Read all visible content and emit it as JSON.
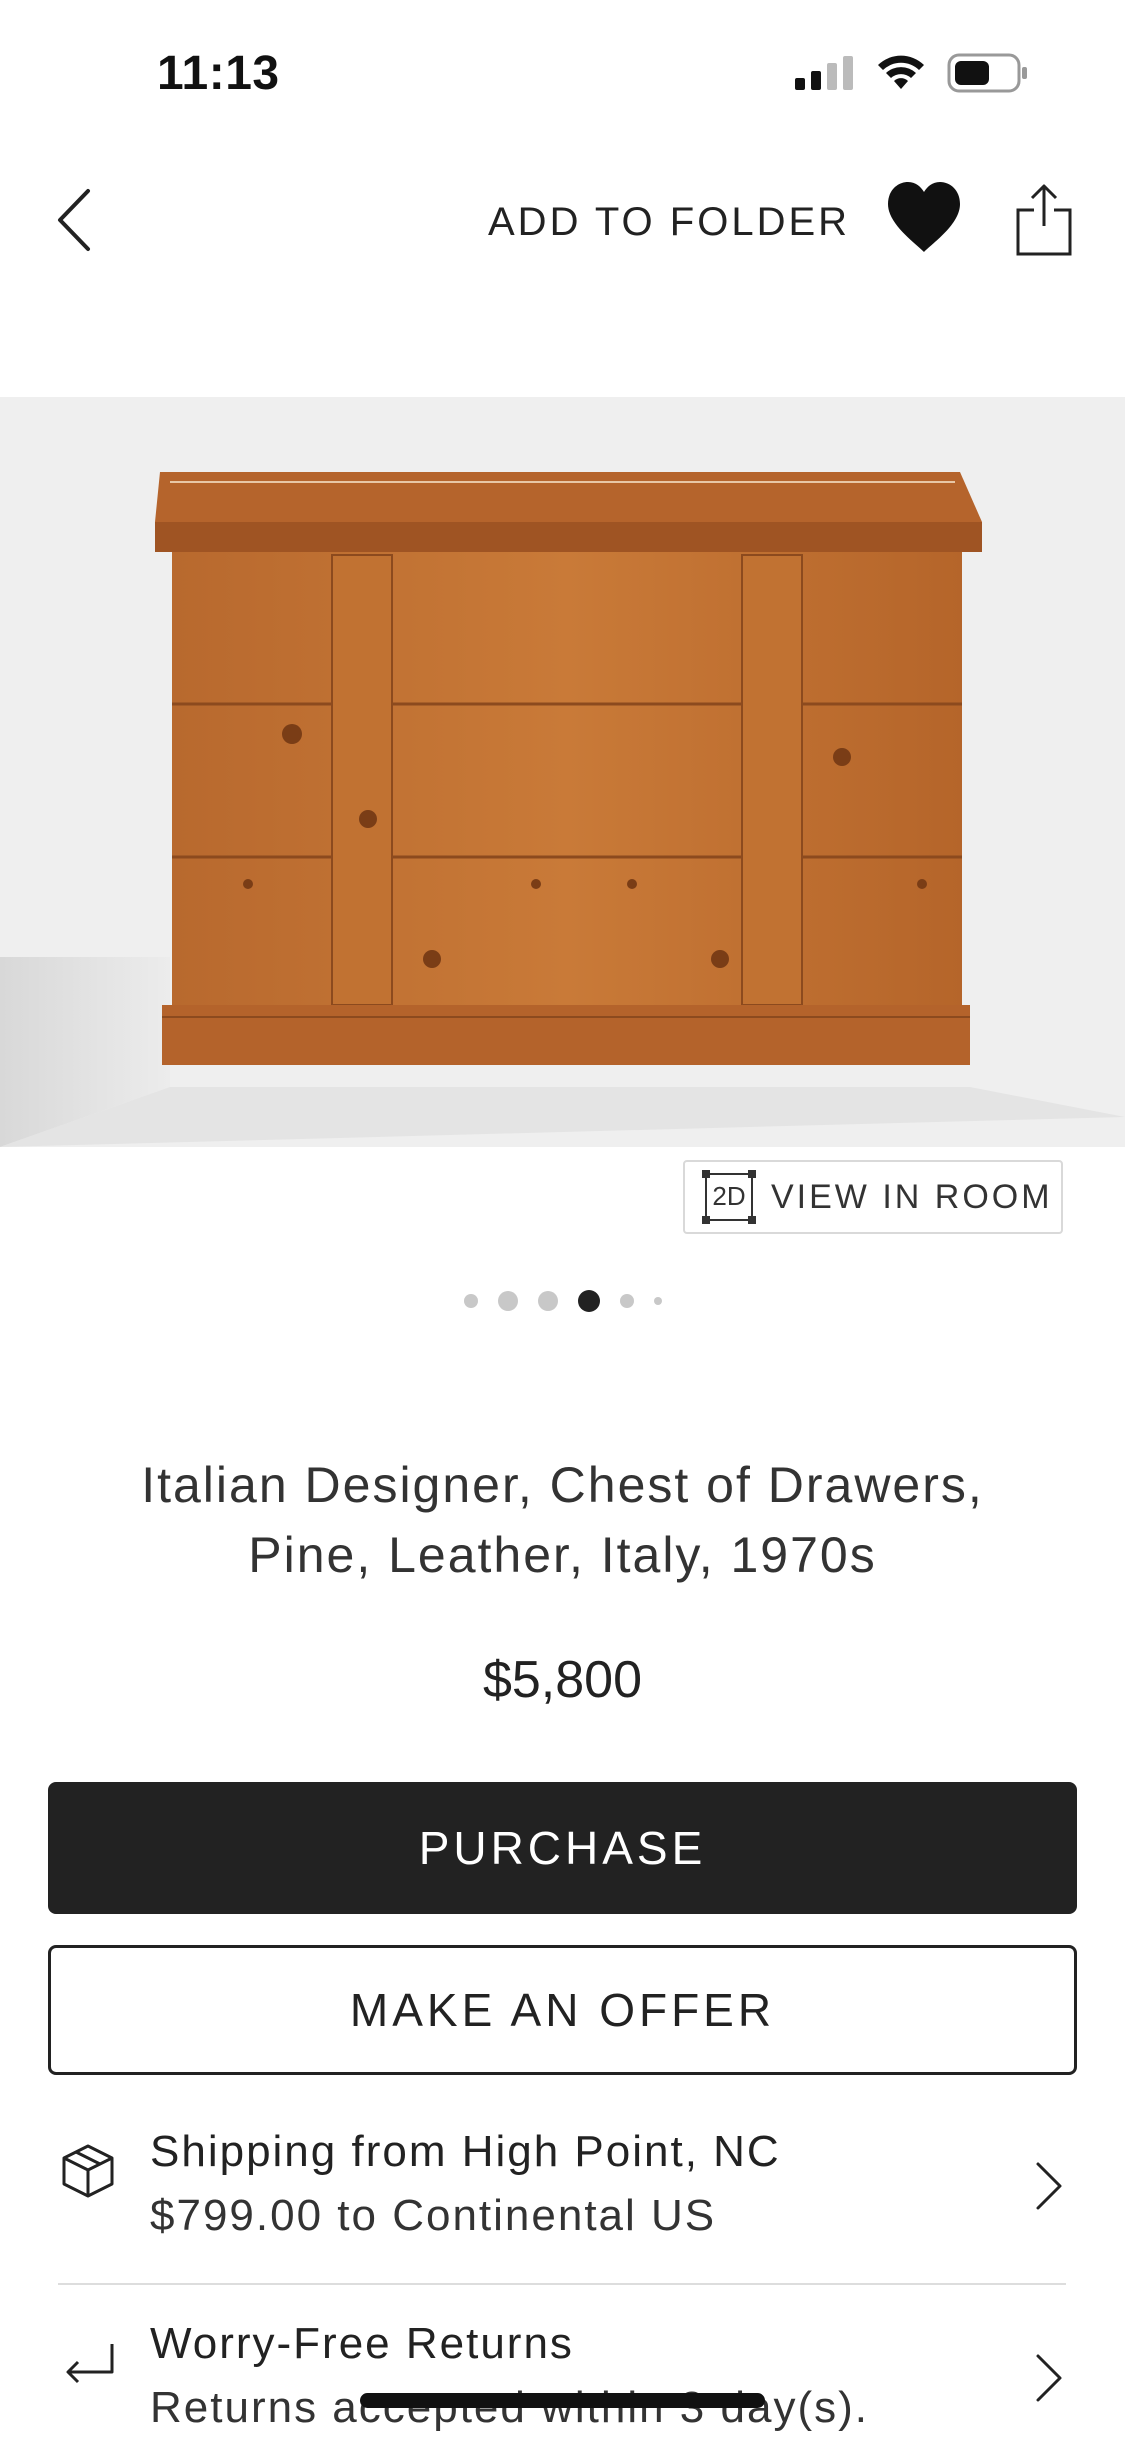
{
  "status_bar": {
    "time": "11:13"
  },
  "nav": {
    "add_to_folder": "ADD TO FOLDER"
  },
  "gallery": {
    "view_in_room_badge": "2D",
    "view_in_room": "VIEW IN ROOM",
    "dot_count": 6,
    "active_dot": 4
  },
  "product": {
    "title_line1": "Italian Designer, Chest of Drawers,",
    "title_line2": "Pine, Leather, Italy, 1970s",
    "price": "$5,800"
  },
  "actions": {
    "purchase": "PURCHASE",
    "make_offer": "MAKE AN OFFER"
  },
  "info_rows": [
    {
      "title": "Shipping from High Point, NC",
      "subtitle": "$799.00 to Continental US",
      "icon": "box-icon"
    },
    {
      "title": "Worry-Free Returns",
      "subtitle": "Returns accepted within 3 day(s).",
      "icon": "return-arrow-icon"
    }
  ],
  "colors": {
    "primary_button": "#222222",
    "accent_heart": "#111111",
    "hero_bg": "#efefef"
  }
}
